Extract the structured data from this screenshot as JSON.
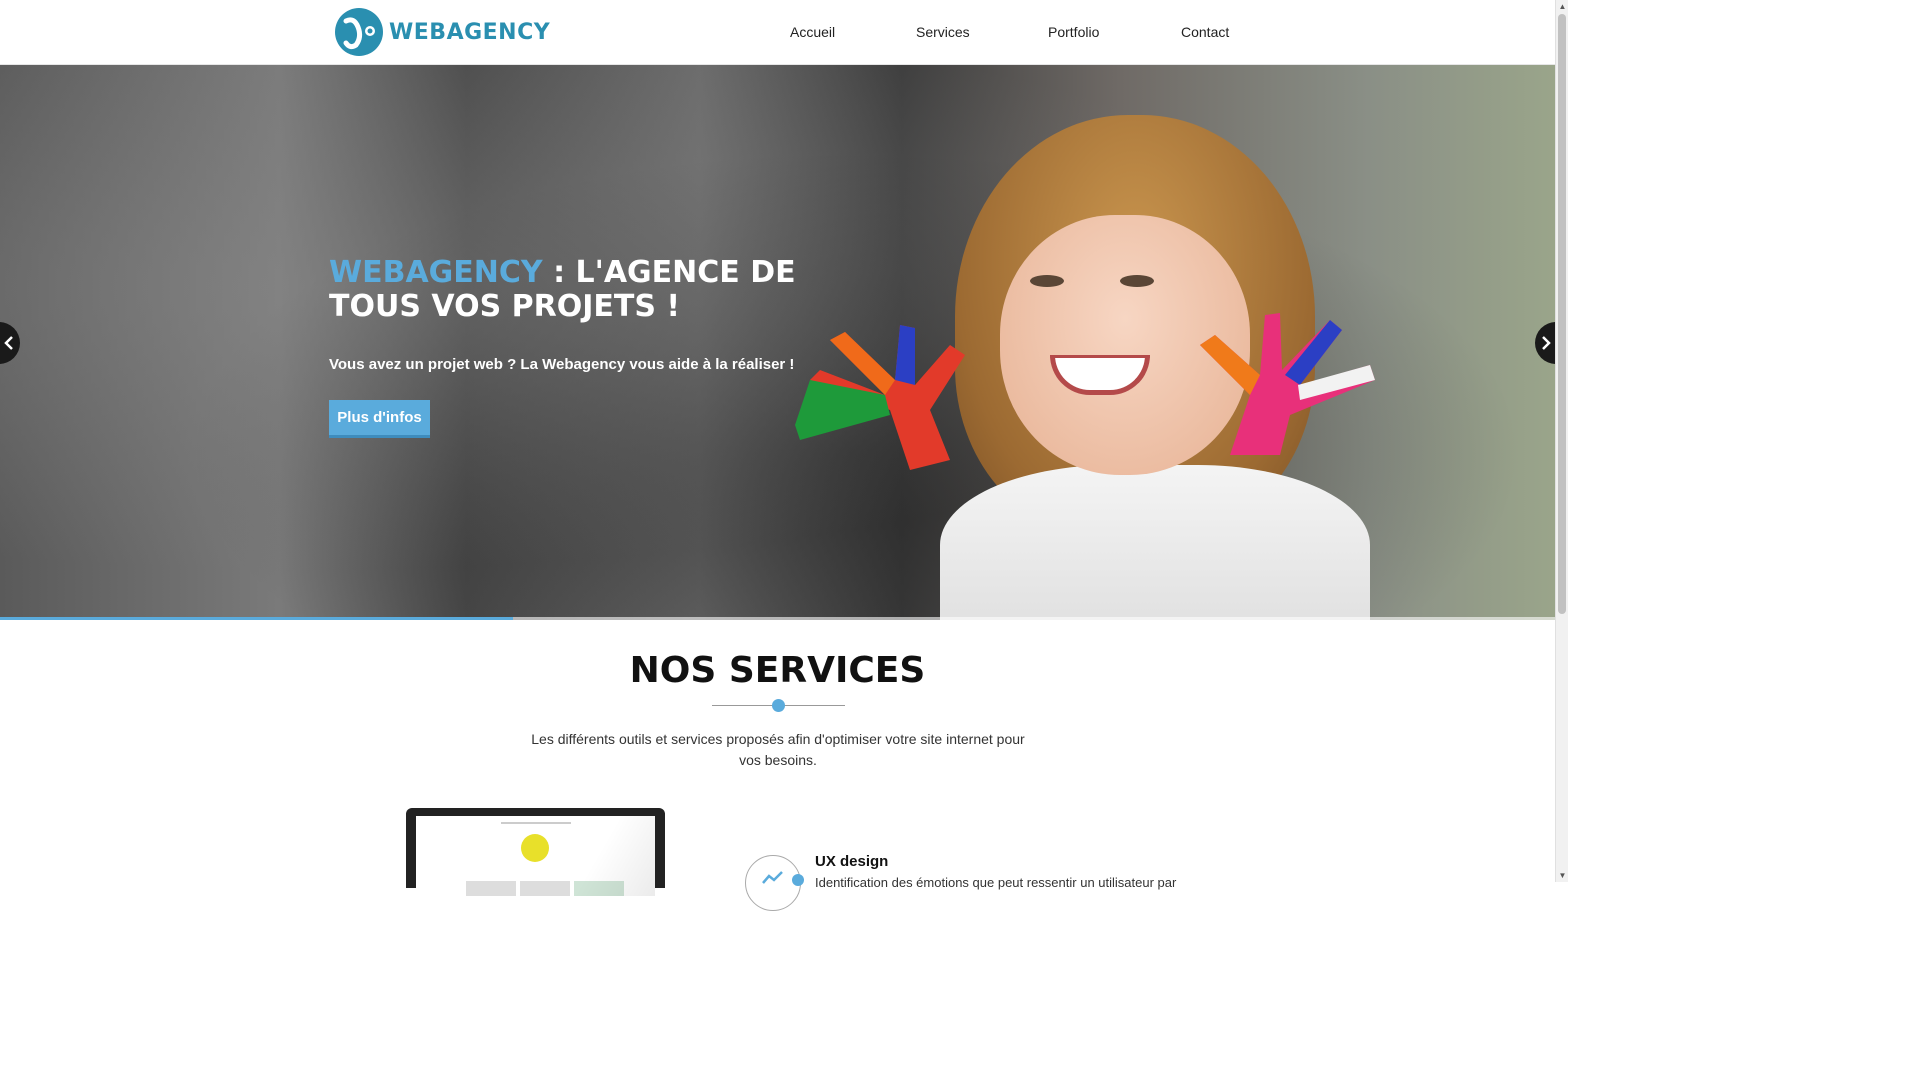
{
  "header": {
    "logo_text": "WEBAGENCY",
    "nav": [
      {
        "label": "Accueil"
      },
      {
        "label": "Services"
      },
      {
        "label": "Portfolio"
      },
      {
        "label": "Contact"
      }
    ]
  },
  "hero": {
    "title_accent": "WEBAGENCY",
    "title_rest": " : L'AGENCE DE TOUS VOS PROJETS !",
    "subtitle": "Vous avez un projet web ? La Webagency vous aide à la réaliser !",
    "button_label": "Plus d'infos",
    "slider_progress_percent": 33,
    "prev_icon": "chevron-left-icon",
    "next_icon": "chevron-right-icon"
  },
  "services": {
    "title": "NOS SERVICES",
    "description": "Les différents outils et services proposés afin d'optimiser votre site internet pour vos besoins.",
    "items": [
      {
        "title": "UX design",
        "text": "Identification des émotions que peut ressentir un utilisateur par",
        "icon": "chart-icon"
      }
    ]
  },
  "colors": {
    "accent": "#5aabdc",
    "logo": "#2a8fb0"
  }
}
